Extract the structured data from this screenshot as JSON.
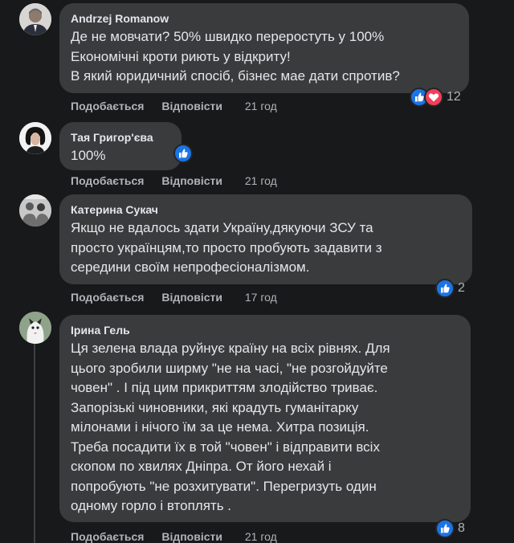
{
  "comments": [
    {
      "author": "Andrzej Romanow",
      "lines": [
        "Де не мовчати? 50% швидко переростуть у 100%",
        "Економічні кроти риють у відкриту!",
        "В який юридичний спосіб, бізнес мае дати спротив?"
      ],
      "like_label": "Подобається",
      "reply_label": "Відповісти",
      "time": "21 год",
      "reaction_count": "12",
      "reactions": [
        "like-icon",
        "love-icon"
      ]
    },
    {
      "author": "Тая Григор'єва",
      "lines": [
        "100%"
      ],
      "like_label": "Подобається",
      "reply_label": "Відповісти",
      "time": "21 год",
      "reaction_count": "",
      "reactions": [
        "like-icon"
      ]
    },
    {
      "author": "Катерина Сукач",
      "lines": [
        "Якщо не вдалось здати Україну,дякуючи ЗСУ та",
        "просто українцям,то просто пробують задавити з",
        "середини своїм непрофесіоналізмом."
      ],
      "like_label": "Подобається",
      "reply_label": "Відповісти",
      "time": "17 год",
      "reaction_count": "2",
      "reactions": [
        "like-icon"
      ]
    },
    {
      "author": "Ірина Гель",
      "lines": [
        "Ця зелена влада руйнує країну на всіх рівнях. Для",
        "цього зробили ширму \"не на часі, \"не розгойдуйте",
        "човен\" . І під цим прикриттям злодійство триває.",
        "Запорізькі чиновники, які крадуть гуманітарку",
        "мілонами і нічого їм за це нема. Хитра позиція.",
        "Треба посадити їх в той \"човен\" і відправити всіх",
        "скопом по хвилях Дніпра. От його нехай і",
        "попробують \"не розхитувати\". Перегризуть один",
        "одному горло і втоплять ."
      ],
      "like_label": "Подобається",
      "reply_label": "Відповісти",
      "time": "21 год",
      "reaction_count": "8",
      "reactions": [
        "like-icon"
      ]
    }
  ],
  "colors": {
    "background": "#18191a",
    "bubble": "#3a3b3c",
    "text": "#e4e6eb",
    "secondary_text": "#b0b3b8",
    "like_blue": "#1b74e4",
    "love_red": "#f33e58"
  }
}
